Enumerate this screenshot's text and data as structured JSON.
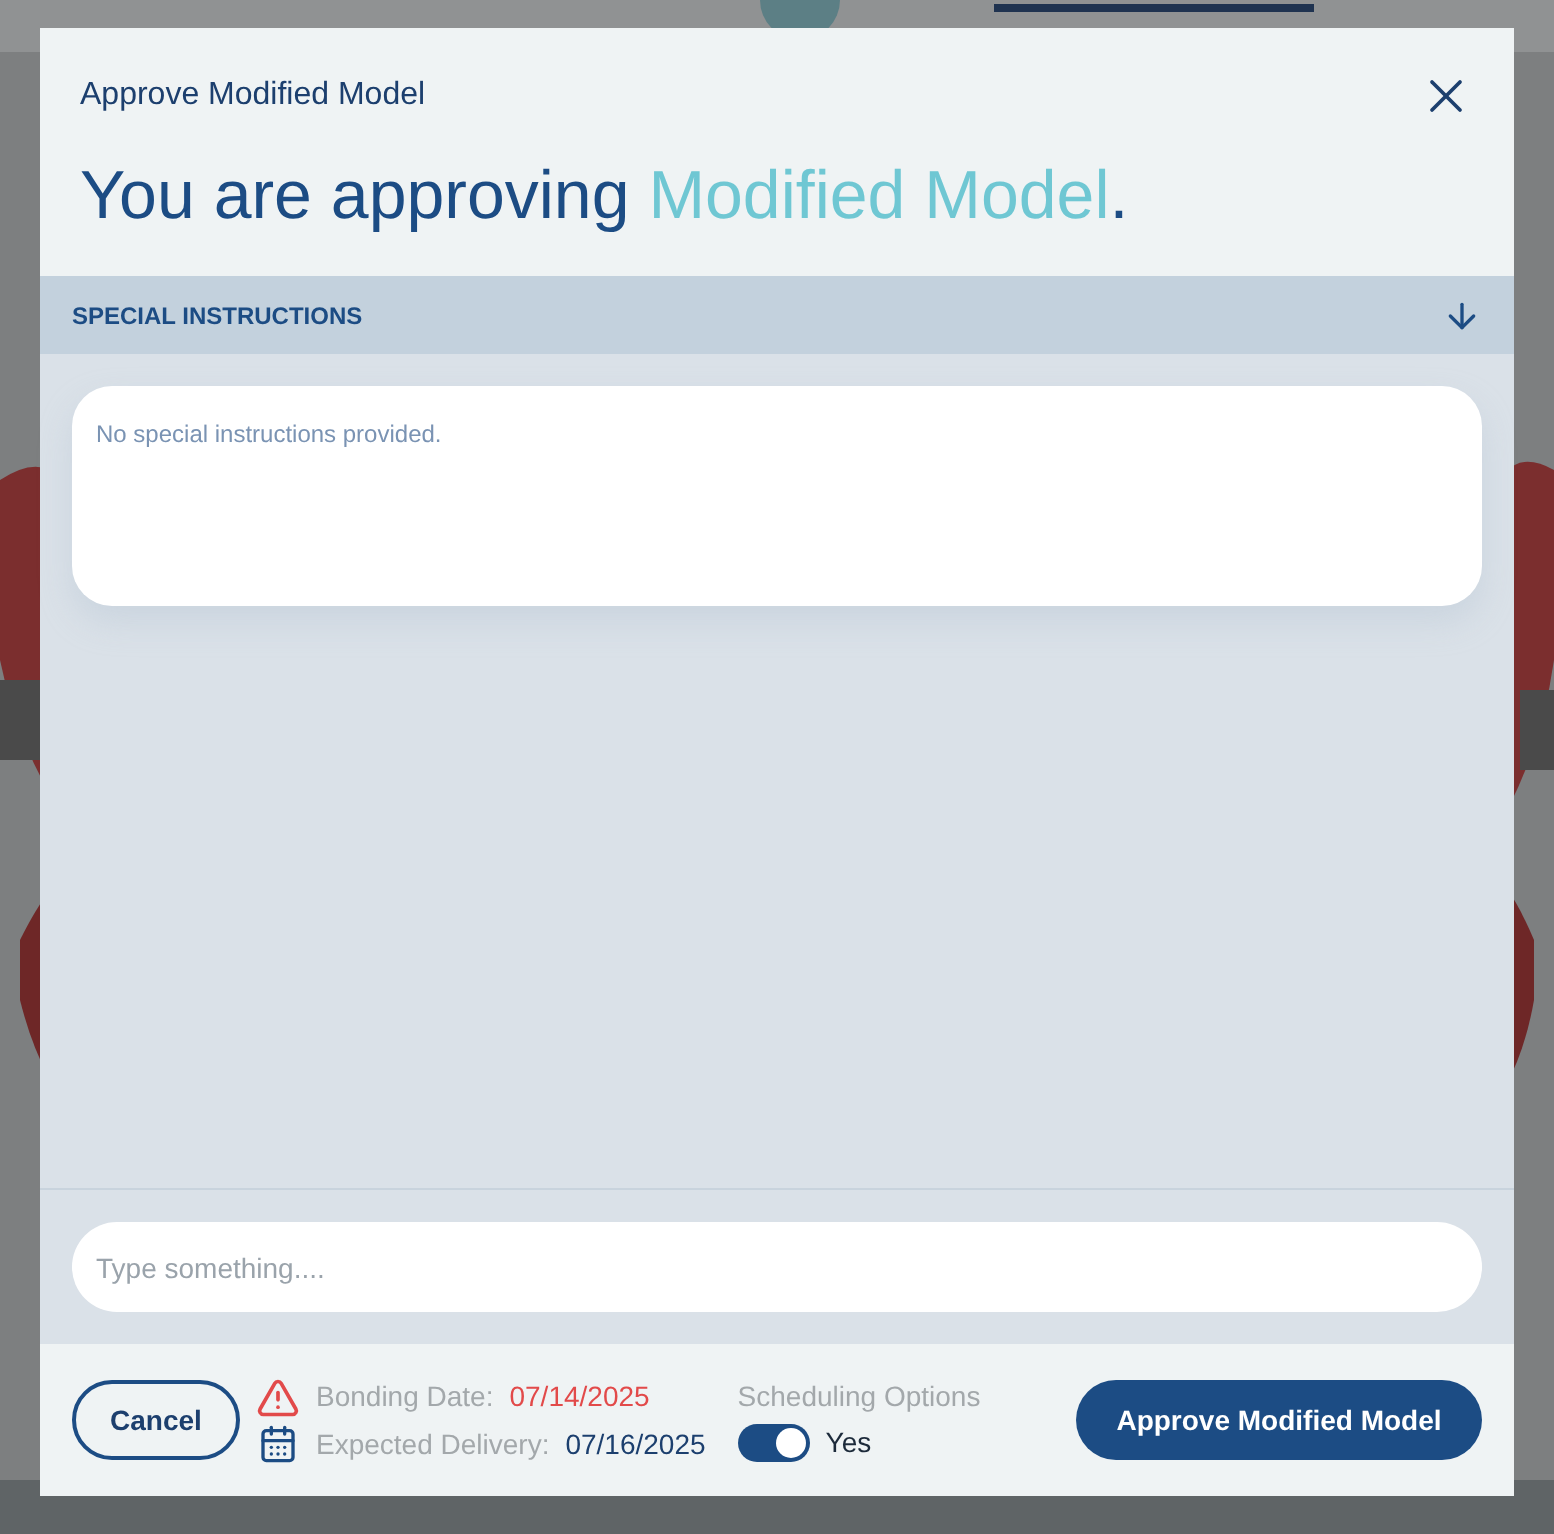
{
  "dialog": {
    "title": "Approve Modified Model",
    "heading": {
      "prefix": "You are approving ",
      "highlight": "Modified Model",
      "suffix": "."
    }
  },
  "section": {
    "title": "SPECIAL INSTRUCTIONS",
    "expanded": true,
    "text": "No special instructions provided."
  },
  "message": {
    "placeholder": "Type something...."
  },
  "footer": {
    "cancel": "Cancel",
    "dates": [
      {
        "kind": "warning",
        "label": "Bonding Date:",
        "value": "07/14/2025"
      },
      {
        "kind": "calendar",
        "label": "Expected Delivery:",
        "value": "07/16/2025"
      }
    ],
    "scheduling": {
      "label": "Scheduling Options",
      "on": true,
      "value": "Yes"
    },
    "approve": "Approve Modified Model"
  }
}
